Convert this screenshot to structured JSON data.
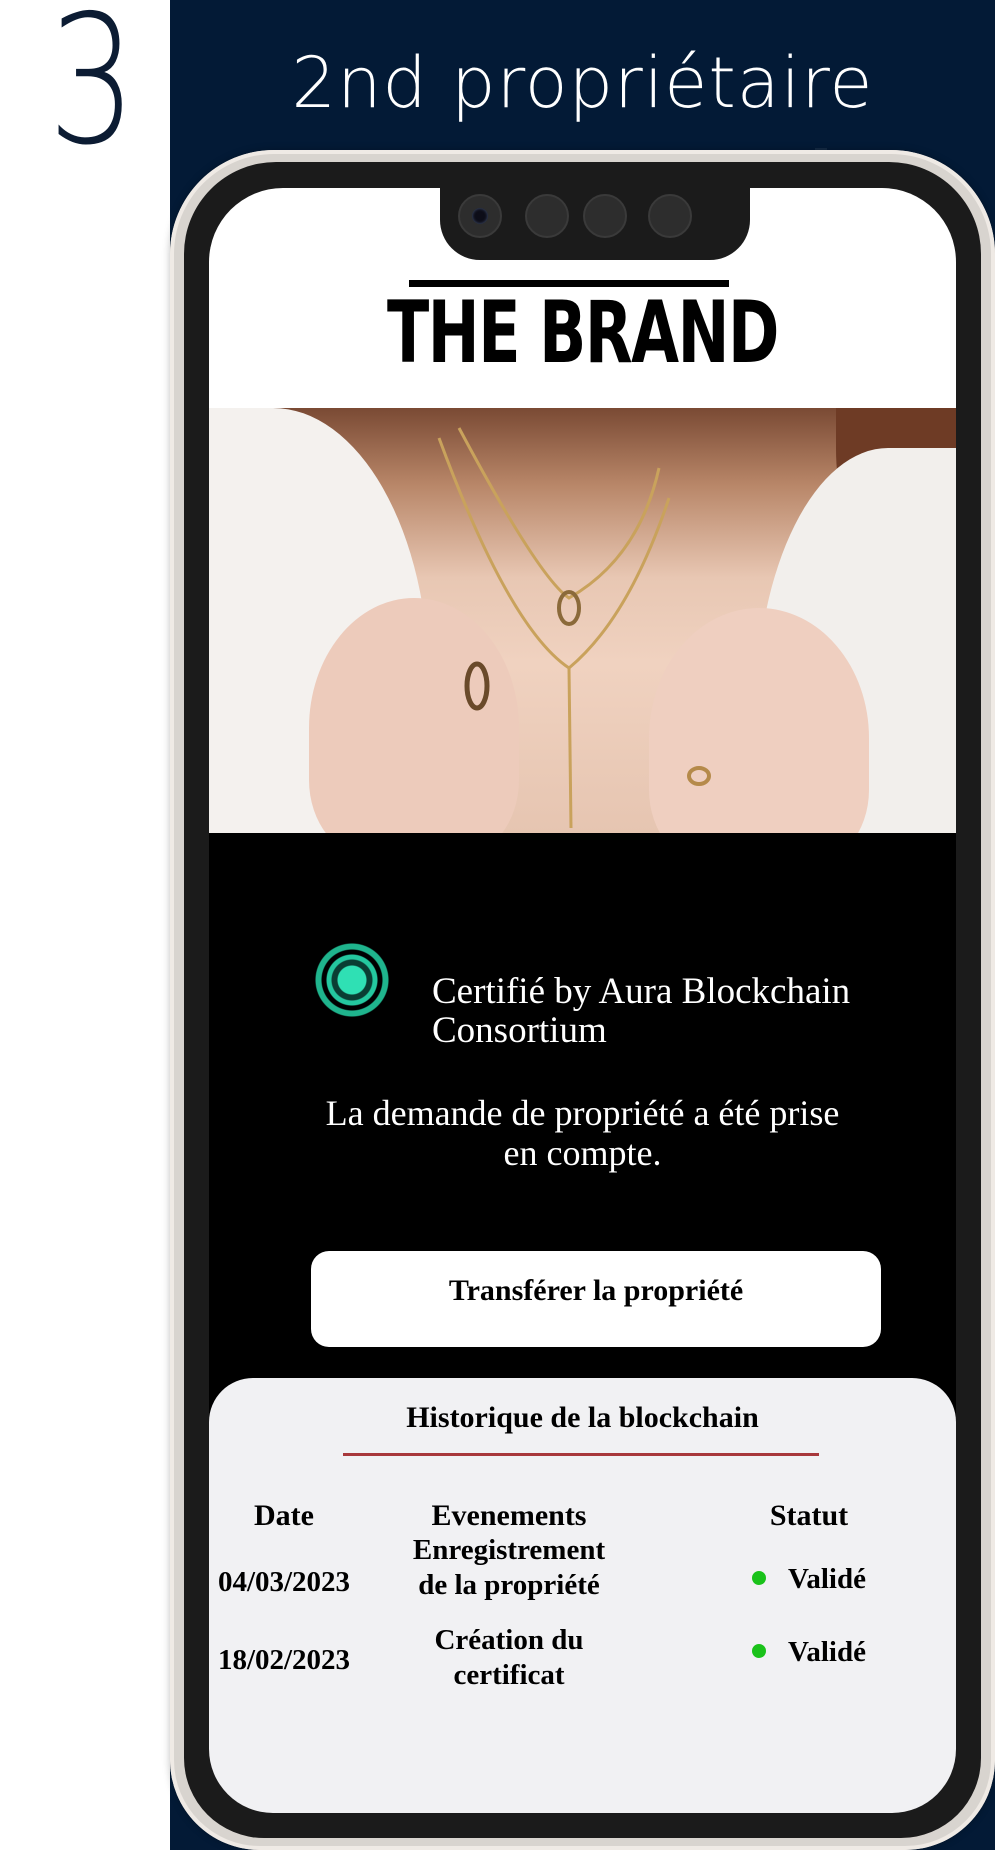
{
  "step": {
    "number": "3",
    "title": "2nd propriétaire"
  },
  "brand": {
    "logo_text": "THE BRAND"
  },
  "certification": {
    "line1": "Certifié by Aura Blockchain",
    "line2": "Consortium",
    "logo_icon": "aura-blockchain-logo-icon"
  },
  "claim": {
    "line1": "La demande de propriété a été prise",
    "line2": "en compte."
  },
  "transfer_button": {
    "label": "Transférer la propriété"
  },
  "history": {
    "title": "Historique de la blockchain",
    "columns": {
      "date": "Date",
      "event": "Evenements",
      "status": "Statut"
    },
    "rows": [
      {
        "date": "04/03/2023",
        "event_line1": "Enregistrement",
        "event_line2": "de la propriété",
        "status": "Validé"
      },
      {
        "date": "18/02/2023",
        "event_line1": "Création du",
        "event_line2": "certificat",
        "status": "Validé"
      }
    ],
    "status_color": "#1ac21a",
    "divider_color": "#a8383b"
  },
  "colors": {
    "navy": "#031a36",
    "screen_bg": "#000000",
    "panel_bg": "#f1f1f3"
  }
}
